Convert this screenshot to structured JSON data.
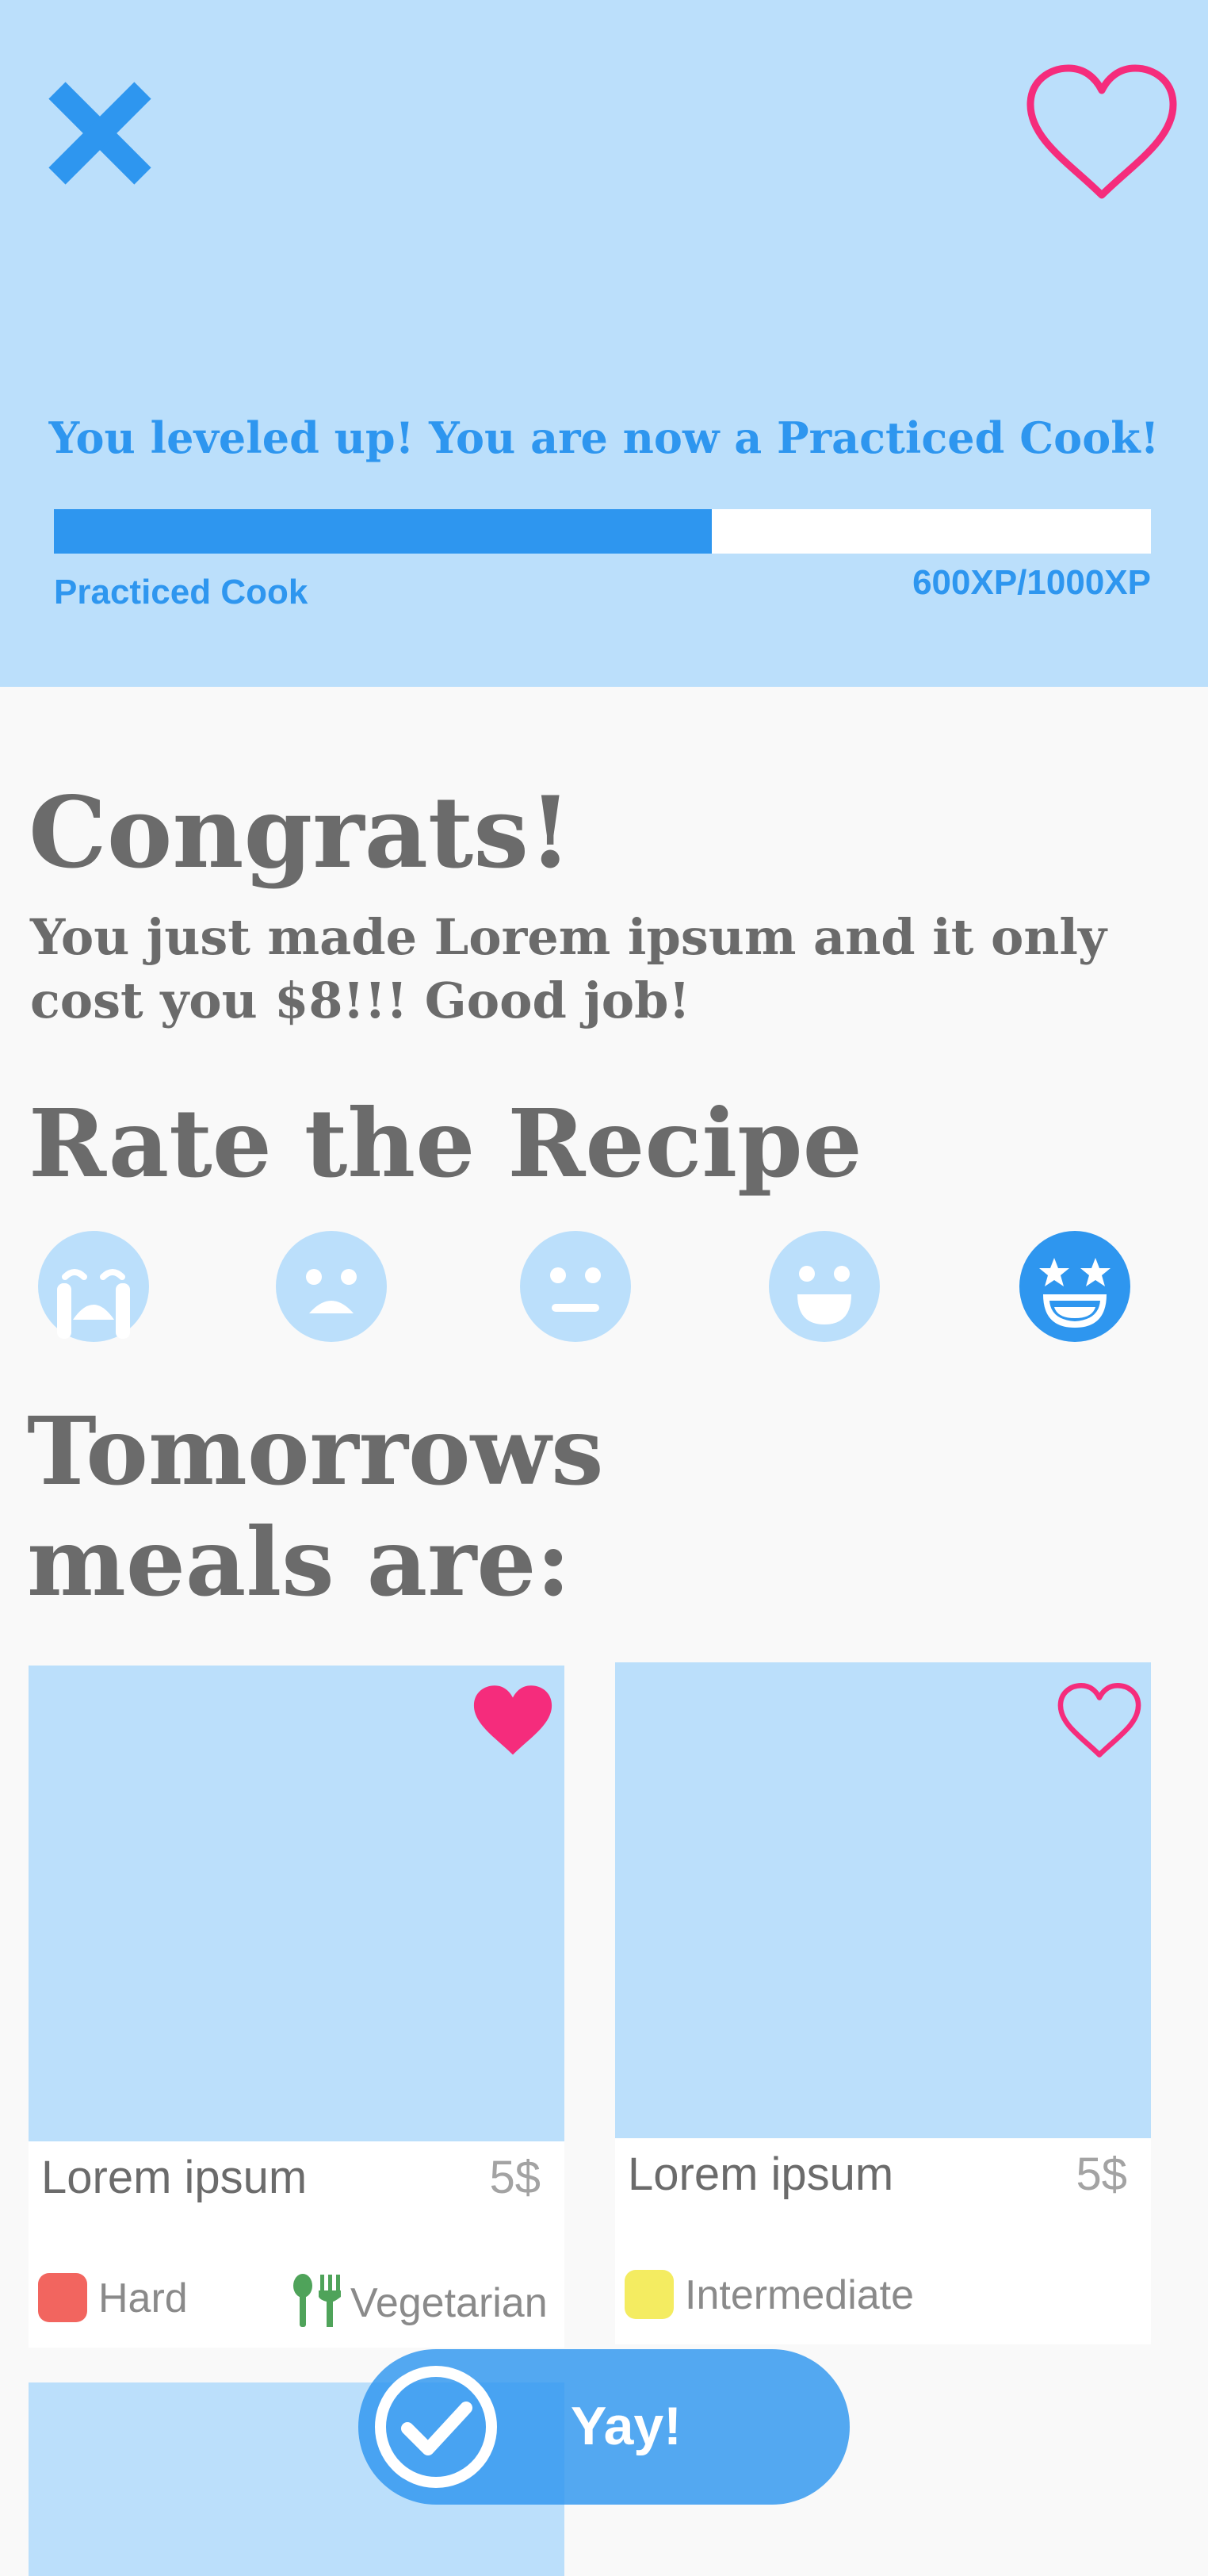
{
  "header": {
    "level_up_message": "You leveled up! You are now a Practiced Cook!",
    "progress": {
      "current_xp": 600,
      "max_xp": 1000,
      "fraction": 0.6
    },
    "rank_label": "Practiced Cook",
    "xp_text": "600XP/1000XP",
    "close_icon": "close-icon",
    "favorite_icon": "heart-outline-icon"
  },
  "congrats": {
    "title": "Congrats!",
    "message": "You just made Lorem ipsum and it only cost you $8!!! Good job!"
  },
  "rating": {
    "title": "Rate the Recipe",
    "options": [
      "crying-face-icon",
      "sad-face-icon",
      "neutral-face-icon",
      "happy-face-icon",
      "star-struck-face-icon"
    ],
    "selected_index": 4
  },
  "tomorrow": {
    "title": "Tomorrows meals are:",
    "meals": [
      {
        "title": "Lorem ipsum",
        "price": "5$",
        "difficulty": "Hard",
        "diet": "Vegetarian",
        "favorited": true
      },
      {
        "title": "Lorem ipsum",
        "price": "5$",
        "difficulty": "Intermediate",
        "diet": "",
        "favorited": false
      }
    ]
  },
  "confirm_button": {
    "label": "Yay!",
    "icon": "check-circle-icon"
  },
  "colors": {
    "header_bg": "#bbdffb",
    "accent_blue": "#2e96ef",
    "light_blue": "#bbdffb",
    "heart_pink": "#f52c7c",
    "text_gray": "#6b6b6b",
    "hard_red": "#f2655f",
    "intermediate_yellow": "#f4ec61",
    "vegetarian_green": "#4fa35a"
  }
}
